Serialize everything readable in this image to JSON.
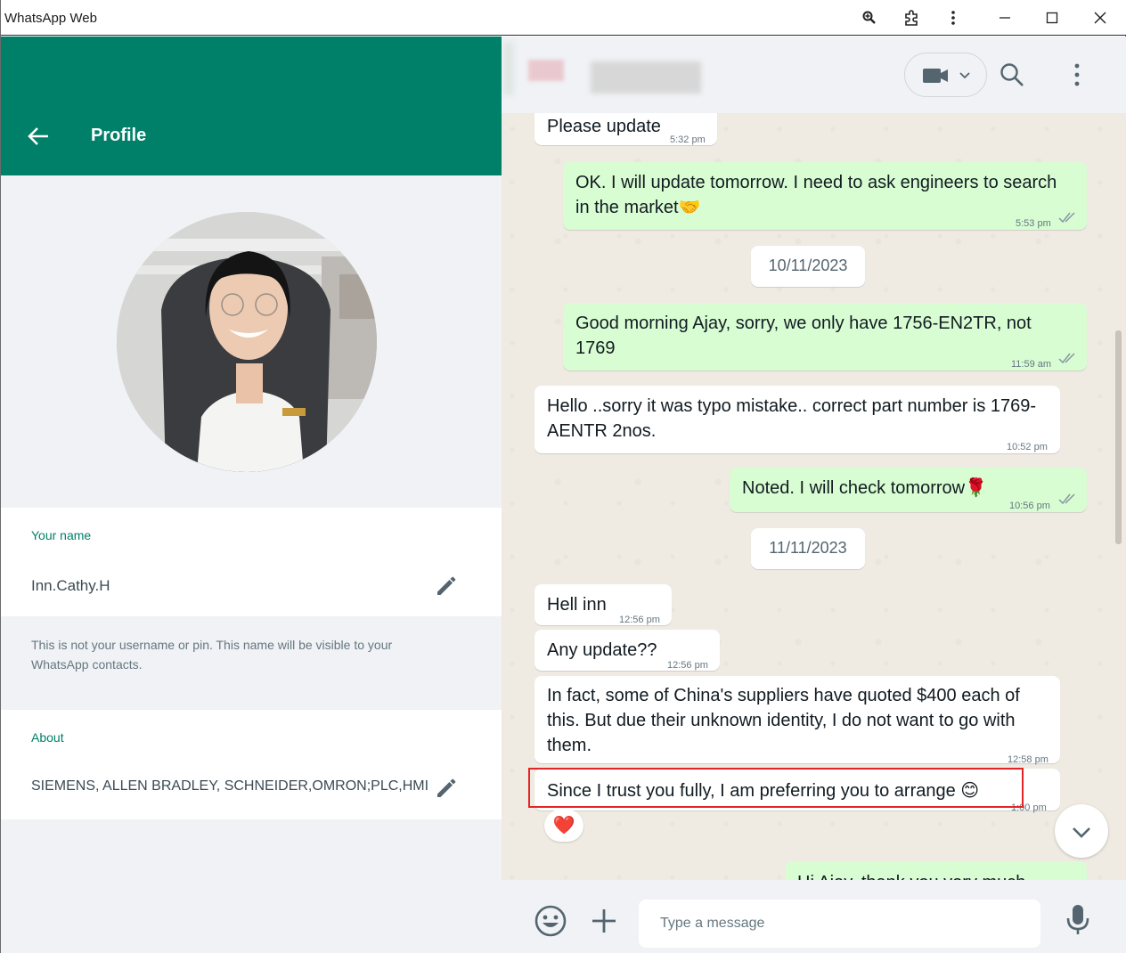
{
  "window": {
    "title": "WhatsApp Web",
    "buttons": [
      "zoom-icon",
      "extensions-icon",
      "more-icon",
      "minimize-icon",
      "maximize-icon",
      "close-icon"
    ]
  },
  "profile": {
    "header_title": "Profile",
    "name_label": "Your name",
    "name_value": "Inn.Cathy.H",
    "name_hint": "This is not your username or pin. This name will be visible to your WhatsApp contacts.",
    "about_label": "About",
    "about_value": "SIEMENS, ALLEN BRADLEY, SCHNEIDER,OMRON;PLC,HMI"
  },
  "chat": {
    "messages": [
      {
        "dir": "in",
        "text": "Please update",
        "time": "5:32 pm"
      },
      {
        "dir": "out",
        "text": "OK. I will update tomorrow. I need to ask engineers to search",
        "text2": "in the market🤝",
        "time": "5:53 pm"
      },
      {
        "dir": "date",
        "text": "10/11/2023"
      },
      {
        "dir": "out",
        "text": "Good morning Ajay, sorry, we only have 1756-EN2TR, not",
        "text2": "1769",
        "time": "11:59 am"
      },
      {
        "dir": "in",
        "text": "Hello ..sorry it was typo mistake.. correct part number is 1769-",
        "text2": "AENTR 2nos.",
        "time": "10:52 pm"
      },
      {
        "dir": "out",
        "text": "Noted. I will check tomorrow🌹",
        "time": "10:56 pm"
      },
      {
        "dir": "date",
        "text": "11/11/2023"
      },
      {
        "dir": "in",
        "text": "Hell inn",
        "time": "12:56 pm"
      },
      {
        "dir": "in",
        "text": "Any update??",
        "time": "12:56 pm"
      },
      {
        "dir": "in",
        "text": "In fact, some of China's suppliers have quoted $400 each of",
        "text2": "this. But due their unknown identity, I do not want to go with",
        "text3": "them.",
        "time": "12:58 pm"
      },
      {
        "dir": "in",
        "text": "Since I trust you fully, I am preferring you to arrange 😊",
        "time": "1:00 pm"
      },
      {
        "dir": "out",
        "text": "Hi Ajay, thank you very much",
        "time": ""
      }
    ],
    "reaction": "❤️",
    "input_placeholder": "Type a message"
  },
  "colors": {
    "header_green": "#008069",
    "outgoing_bubble": "#d9fdd3",
    "chat_background": "#efeae2",
    "highlight_border": "#e32424"
  }
}
